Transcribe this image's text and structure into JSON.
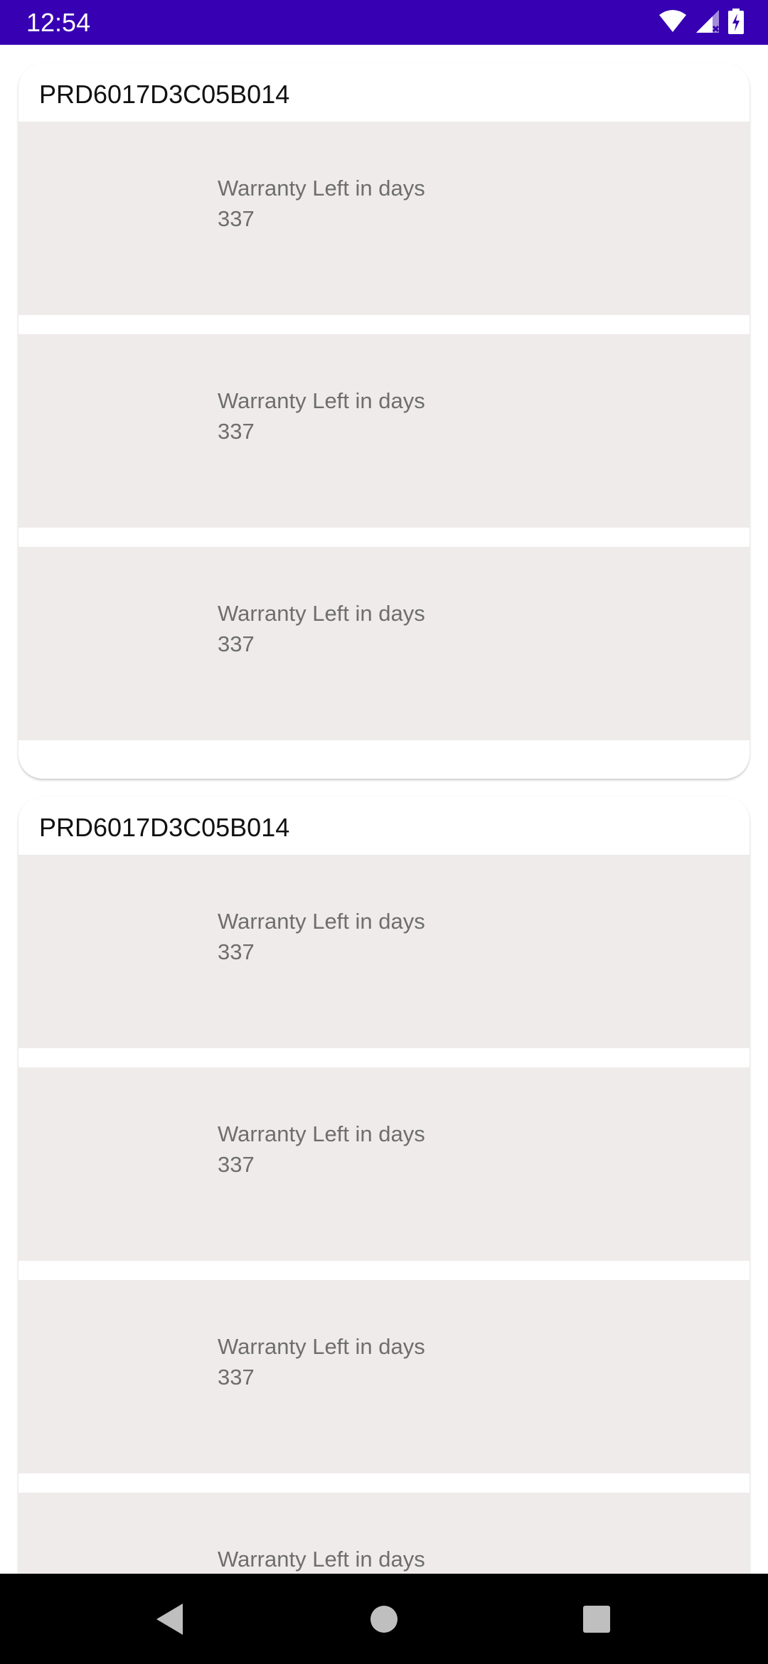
{
  "status_bar": {
    "time": "12:54",
    "icons": [
      "wifi-icon",
      "signal-icon",
      "battery-icon"
    ]
  },
  "colors": {
    "status_bar": "#3700b3",
    "item_background": "#f0ebeb",
    "item_text": "#6e6e6e",
    "nav_bar": "#000000"
  },
  "groups": [
    {
      "title": "PRD6017D3C05B014",
      "items": [
        {
          "label": "Warranty Left in days",
          "value": "337"
        },
        {
          "label": "Warranty Left in days",
          "value": "337"
        },
        {
          "label": "Warranty Left in days",
          "value": "337"
        }
      ]
    },
    {
      "title": "PRD6017D3C05B014",
      "items": [
        {
          "label": "Warranty Left in days",
          "value": "337"
        },
        {
          "label": "Warranty Left in days",
          "value": "337"
        },
        {
          "label": "Warranty Left in days",
          "value": "337"
        },
        {
          "label": "Warranty Left in days",
          "value": ""
        }
      ]
    }
  ],
  "nav_bar": {
    "buttons": [
      "back-icon",
      "home-icon",
      "recents-icon"
    ]
  }
}
